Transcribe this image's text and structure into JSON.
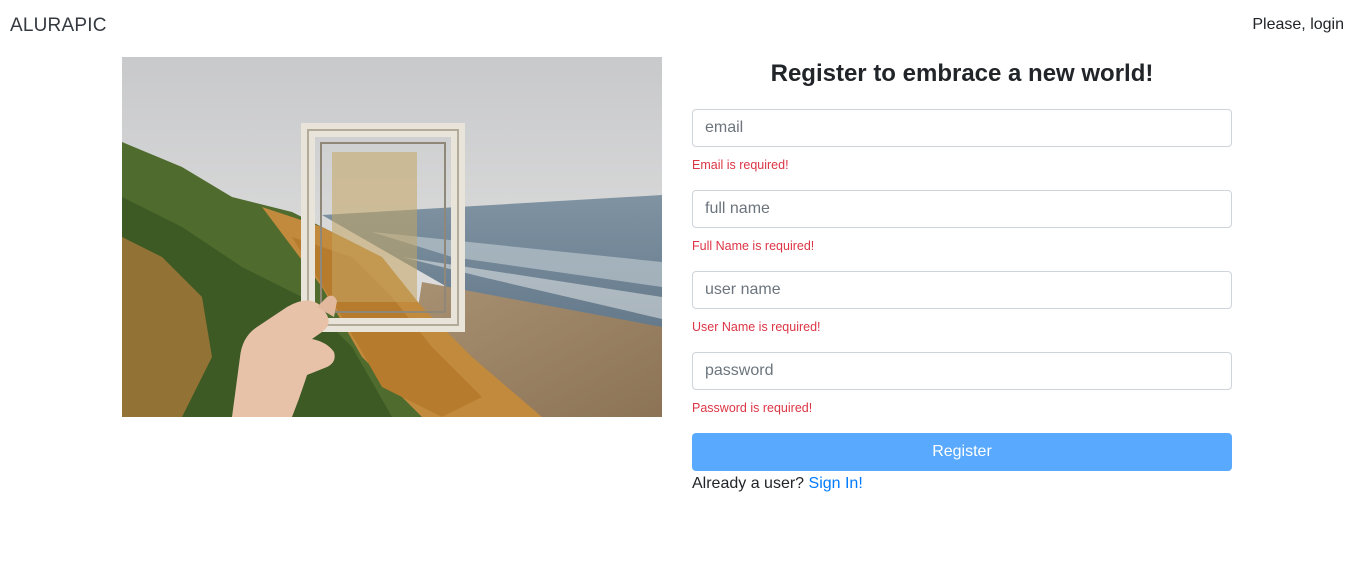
{
  "navbar": {
    "brand": "ALURAPIC",
    "login_text": "Please, login"
  },
  "image": {
    "alt": "hand holding a wooden picture frame over a coastal cliff and beach"
  },
  "form": {
    "title": "Register to embrace a new world!",
    "fields": [
      {
        "placeholder": "email",
        "value": "",
        "error": "Email is required!"
      },
      {
        "placeholder": "full name",
        "value": "",
        "error": "Full Name is required!"
      },
      {
        "placeholder": "user name",
        "value": "",
        "error": "User Name is required!"
      },
      {
        "placeholder": "password",
        "value": "",
        "error": "Password is required!"
      }
    ],
    "submit_label": "Register",
    "already_user_text": "Already a user?",
    "signin_link": "Sign In!"
  },
  "colors": {
    "button_bg": "#59a9ff",
    "error": "#dc3545",
    "link": "#007bff"
  }
}
